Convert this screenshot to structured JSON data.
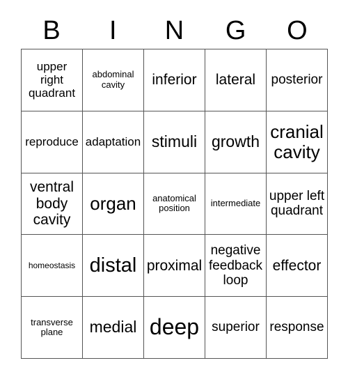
{
  "card": {
    "header_letters": [
      "B",
      "I",
      "N",
      "G",
      "O"
    ],
    "grid_size": "5x5",
    "border_color": "#555555",
    "text_color": "#000000",
    "background_color": "#ffffff",
    "cells": [
      {
        "text": "upper right quadrant",
        "size": "md"
      },
      {
        "text": "abdominal cavity",
        "size": "sm"
      },
      {
        "text": "inferior",
        "size": "xl"
      },
      {
        "text": "lateral",
        "size": "xl"
      },
      {
        "text": "posterior",
        "size": "lg"
      },
      {
        "text": "reproduce",
        "size": "md"
      },
      {
        "text": "adaptation",
        "size": "md"
      },
      {
        "text": "stimuli",
        "size": "2xl"
      },
      {
        "text": "growth",
        "size": "2xl"
      },
      {
        "text": "cranial cavity",
        "size": "3xl"
      },
      {
        "text": "ventral body cavity",
        "size": "xl"
      },
      {
        "text": "organ",
        "size": "3xl"
      },
      {
        "text": "anatomical position",
        "size": "sm"
      },
      {
        "text": "intermediate",
        "size": "sm"
      },
      {
        "text": "upper left quadrant",
        "size": "lg"
      },
      {
        "text": "homeostasis",
        "size": "xs"
      },
      {
        "text": "distal",
        "size": "4xl"
      },
      {
        "text": "proximal",
        "size": "xl"
      },
      {
        "text": "negative feedback loop",
        "size": "lg"
      },
      {
        "text": "effector",
        "size": "xl"
      },
      {
        "text": "transverse plane",
        "size": "sm"
      },
      {
        "text": "medial",
        "size": "2xl"
      },
      {
        "text": "deep",
        "size": "5xl"
      },
      {
        "text": "superior",
        "size": "lg"
      },
      {
        "text": "response",
        "size": "lg"
      }
    ]
  }
}
